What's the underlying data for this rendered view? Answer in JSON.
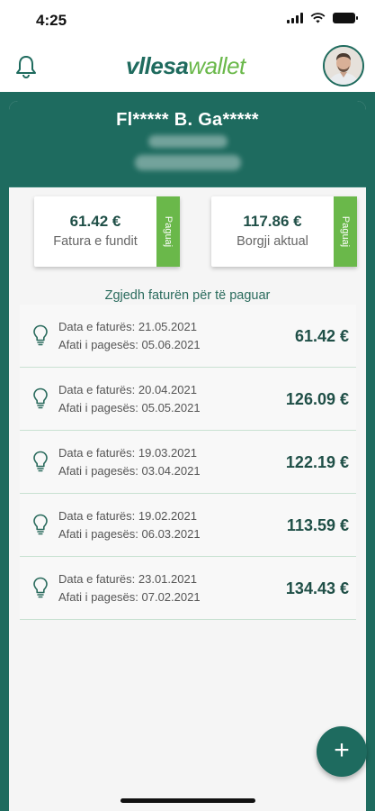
{
  "status_bar": {
    "time": "4:25"
  },
  "header": {
    "logo_part1": "vllesa",
    "logo_part2": "wallet"
  },
  "customer": {
    "name": "Fl***** B. Ga*****"
  },
  "summary": [
    {
      "amount": "61.42 €",
      "label": "Fatura e fundit",
      "pay_label": "Paguaj"
    },
    {
      "amount": "117.86 €",
      "label": "Borgji aktual",
      "pay_label": "Paguaj"
    }
  ],
  "invoice_section": {
    "title": "Zgjedh faturën për të paguar"
  },
  "invoices": [
    {
      "date": "Data e faturës: 21.05.2021",
      "due": "Afati i pagesës: 05.06.2021",
      "amount": "61.42 €"
    },
    {
      "date": "Data e faturës: 20.04.2021",
      "due": "Afati i pagesës: 05.05.2021",
      "amount": "126.09 €"
    },
    {
      "date": "Data e faturës: 19.03.2021",
      "due": "Afati i pagesës: 03.04.2021",
      "amount": "122.19 €"
    },
    {
      "date": "Data e faturës: 19.02.2021",
      "due": "Afati i pagesës: 06.03.2021",
      "amount": "113.59 €"
    },
    {
      "date": "Data e faturës: 23.01.2021",
      "due": "Afati i pagesës: 07.02.2021",
      "amount": "134.43 €"
    }
  ],
  "fab": {
    "label": "+"
  },
  "colors": {
    "primary": "#1e6b5f",
    "accent": "#6ab84a",
    "amount_text": "#1f4f47"
  }
}
